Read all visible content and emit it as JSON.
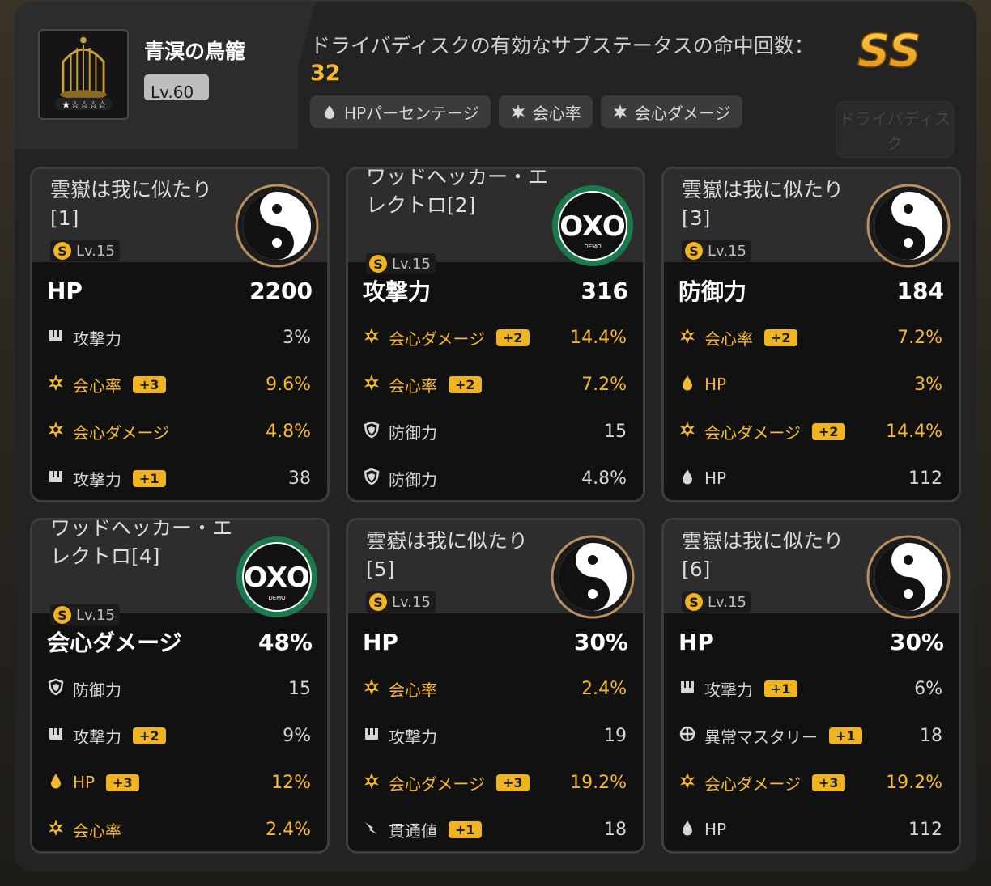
{
  "character": {
    "name": "青溟の鳥籠",
    "level": "Lv.60"
  },
  "summary": {
    "title": "ドライバディスクの有効なサブステータスの命中回数：",
    "count": "32",
    "tags": [
      {
        "icon": "hp-drop-icon",
        "label": "HPパーセンテージ"
      },
      {
        "icon": "crit-icon",
        "label": "会心率"
      },
      {
        "icon": "crit-icon",
        "label": "会心ダメージ"
      }
    ],
    "rank": "SS",
    "drive_disc_button": "ドライバディスク"
  },
  "colors": {
    "accent": "#f5b82e",
    "card_bg": "#111111"
  },
  "discs": [
    {
      "name": "雲嶽は我に似たり[1]",
      "level": "Lv.15",
      "icon": "yunkui-disc-icon",
      "main": {
        "label": "HP",
        "value": "2200"
      },
      "subs": [
        {
          "icon": "attack-icon",
          "label": "攻撃力",
          "plus": "",
          "value": "3%",
          "highlight": false
        },
        {
          "icon": "crit-icon",
          "label": "会心率",
          "plus": "+3",
          "value": "9.6%",
          "highlight": true
        },
        {
          "icon": "crit-icon",
          "label": "会心ダメージ",
          "plus": "",
          "value": "4.8%",
          "highlight": true
        },
        {
          "icon": "attack-icon",
          "label": "攻撃力",
          "plus": "+1",
          "value": "38",
          "highlight": false
        }
      ]
    },
    {
      "name": "ワッドヘッカー・エレクトロ[2]",
      "level": "Lv.15",
      "icon": "oxo-disc-icon",
      "main": {
        "label": "攻撃力",
        "value": "316"
      },
      "subs": [
        {
          "icon": "crit-icon",
          "label": "会心ダメージ",
          "plus": "+2",
          "value": "14.4%",
          "highlight": true
        },
        {
          "icon": "crit-icon",
          "label": "会心率",
          "plus": "+2",
          "value": "7.2%",
          "highlight": true
        },
        {
          "icon": "defense-icon",
          "label": "防御力",
          "plus": "",
          "value": "15",
          "highlight": false
        },
        {
          "icon": "defense-icon",
          "label": "防御力",
          "plus": "",
          "value": "4.8%",
          "highlight": false
        }
      ]
    },
    {
      "name": "雲嶽は我に似たり[3]",
      "level": "Lv.15",
      "icon": "yunkui-disc-icon",
      "main": {
        "label": "防御力",
        "value": "184"
      },
      "subs": [
        {
          "icon": "crit-icon",
          "label": "会心率",
          "plus": "+2",
          "value": "7.2%",
          "highlight": true
        },
        {
          "icon": "hp-drop-icon",
          "label": "HP",
          "plus": "",
          "value": "3%",
          "highlight": true
        },
        {
          "icon": "crit-icon",
          "label": "会心ダメージ",
          "plus": "+2",
          "value": "14.4%",
          "highlight": true
        },
        {
          "icon": "hp-drop-icon",
          "label": "HP",
          "plus": "",
          "value": "112",
          "highlight": false
        }
      ]
    },
    {
      "name": "ワッドヘッカー・エレクトロ[4]",
      "level": "Lv.15",
      "icon": "oxo-disc-icon",
      "main": {
        "label": "会心ダメージ",
        "value": "48%"
      },
      "subs": [
        {
          "icon": "defense-icon",
          "label": "防御力",
          "plus": "",
          "value": "15",
          "highlight": false
        },
        {
          "icon": "attack-icon",
          "label": "攻撃力",
          "plus": "+2",
          "value": "9%",
          "highlight": false
        },
        {
          "icon": "hp-drop-icon",
          "label": "HP",
          "plus": "+3",
          "value": "12%",
          "highlight": true
        },
        {
          "icon": "crit-icon",
          "label": "会心率",
          "plus": "",
          "value": "2.4%",
          "highlight": true
        }
      ]
    },
    {
      "name": "雲嶽は我に似たり[5]",
      "level": "Lv.15",
      "icon": "yunkui-disc-icon",
      "main": {
        "label": "HP",
        "value": "30%"
      },
      "subs": [
        {
          "icon": "crit-icon",
          "label": "会心率",
          "plus": "",
          "value": "2.4%",
          "highlight": true
        },
        {
          "icon": "attack-icon",
          "label": "攻撃力",
          "plus": "",
          "value": "19",
          "highlight": false
        },
        {
          "icon": "crit-icon",
          "label": "会心ダメージ",
          "plus": "+3",
          "value": "19.2%",
          "highlight": true
        },
        {
          "icon": "pierce-icon",
          "label": "貫通値",
          "plus": "+1",
          "value": "18",
          "highlight": false
        }
      ]
    },
    {
      "name": "雲嶽は我に似たり[6]",
      "level": "Lv.15",
      "icon": "yunkui-disc-icon",
      "main": {
        "label": "HP",
        "value": "30%"
      },
      "subs": [
        {
          "icon": "attack-icon",
          "label": "攻撃力",
          "plus": "+1",
          "value": "6%",
          "highlight": false
        },
        {
          "icon": "anomaly-mastery-icon",
          "label": "異常マスタリー",
          "plus": "+1",
          "value": "18",
          "highlight": false
        },
        {
          "icon": "crit-icon",
          "label": "会心ダメージ",
          "plus": "+3",
          "value": "19.2%",
          "highlight": true
        },
        {
          "icon": "hp-drop-icon",
          "label": "HP",
          "plus": "",
          "value": "112",
          "highlight": false
        }
      ]
    }
  ]
}
